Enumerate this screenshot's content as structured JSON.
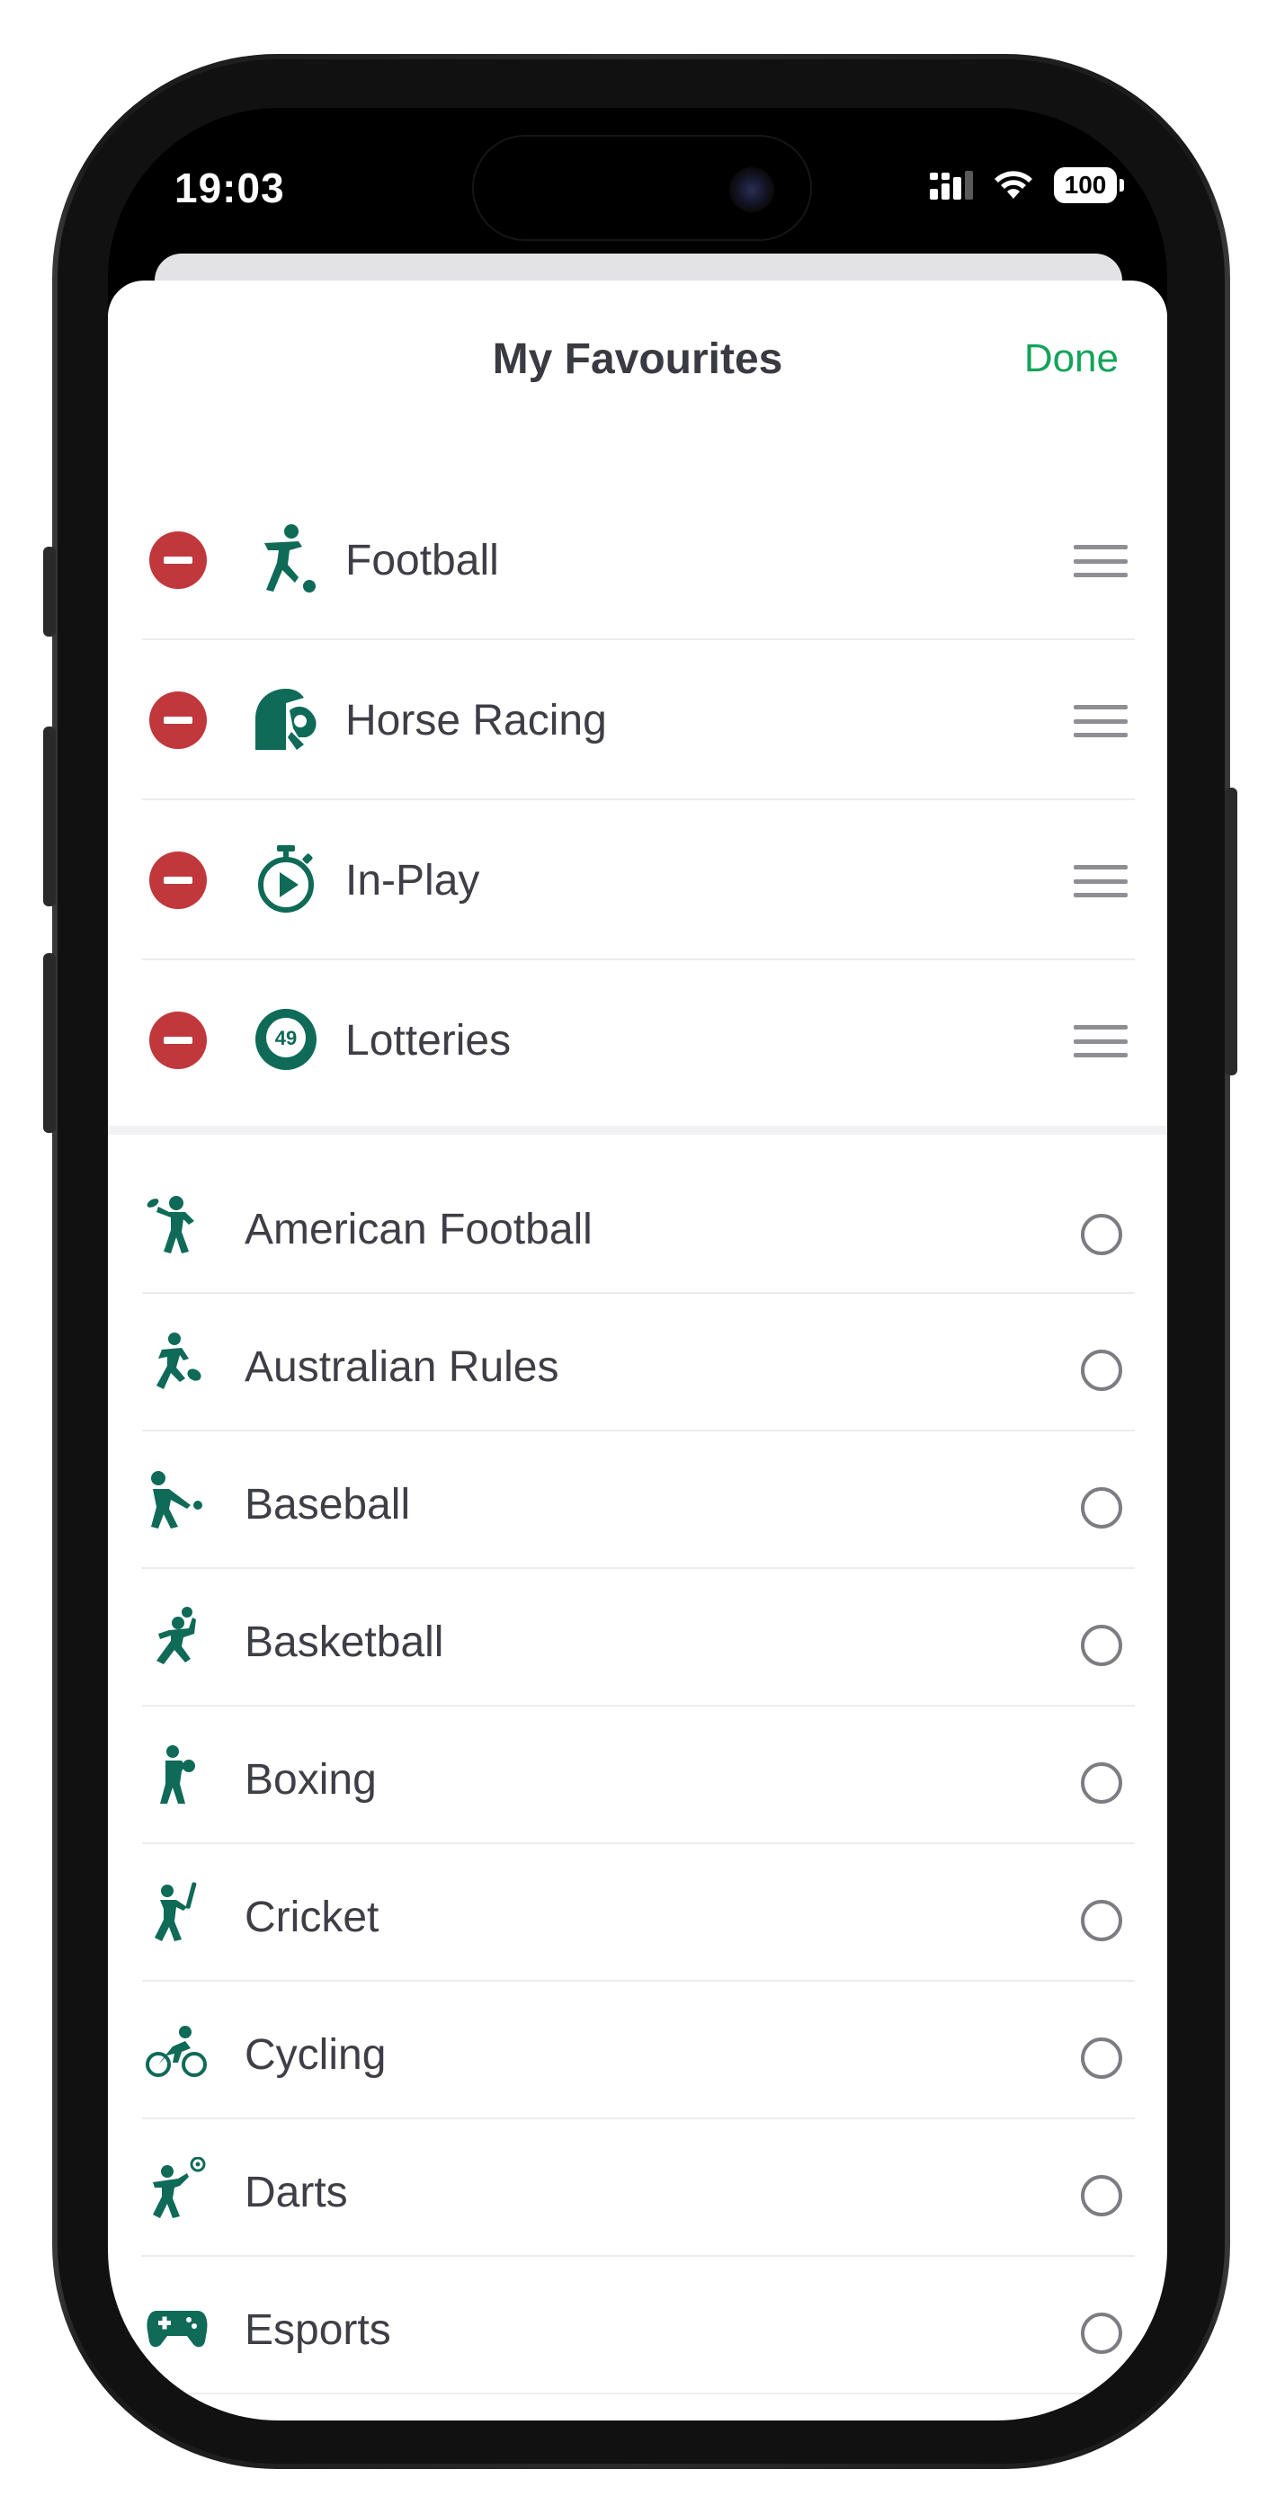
{
  "status_bar": {
    "time": "19:03",
    "battery": "100",
    "icons": [
      "signal-icon",
      "wifi-icon",
      "battery-icon"
    ]
  },
  "sheet": {
    "title": "My Favourites",
    "done_label": "Done",
    "accent_color": "#14a35b",
    "icon_color": "#0f6a58",
    "remove_color": "#c0383c"
  },
  "favourites": [
    {
      "label": "Football",
      "icon": "football-player-icon"
    },
    {
      "label": "Horse Racing",
      "icon": "jockey-helmet-icon"
    },
    {
      "label": "In-Play",
      "icon": "stopwatch-play-icon"
    },
    {
      "label": "Lotteries",
      "icon": "lottery-ball-49-icon",
      "icon_text": "49"
    }
  ],
  "sports": [
    {
      "label": "American Football",
      "icon": "american-football-player-icon"
    },
    {
      "label": "Australian Rules",
      "icon": "aussie-rules-player-icon"
    },
    {
      "label": "Baseball",
      "icon": "baseball-batter-icon"
    },
    {
      "label": "Basketball",
      "icon": "basketball-player-icon"
    },
    {
      "label": "Boxing",
      "icon": "boxer-icon"
    },
    {
      "label": "Cricket",
      "icon": "cricketer-icon"
    },
    {
      "label": "Cycling",
      "icon": "cyclist-icon"
    },
    {
      "label": "Darts",
      "icon": "darts-player-icon"
    },
    {
      "label": "Esports",
      "icon": "gamepad-icon"
    }
  ]
}
